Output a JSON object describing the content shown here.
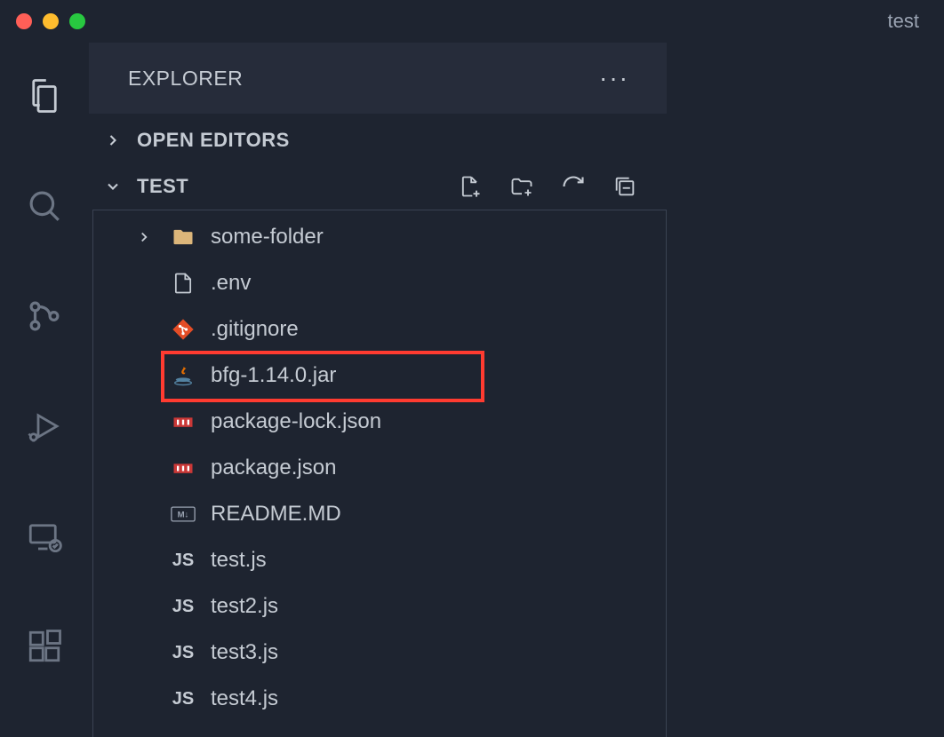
{
  "window": {
    "title": "test"
  },
  "sidebar": {
    "header": "EXPLORER",
    "sections": {
      "open_editors": "OPEN EDITORS",
      "folder": "TEST"
    }
  },
  "tree": {
    "items": [
      {
        "name": "some-folder",
        "type": "folder"
      },
      {
        "name": ".env",
        "type": "file-generic"
      },
      {
        "name": ".gitignore",
        "type": "git"
      },
      {
        "name": "bfg-1.14.0.jar",
        "type": "java",
        "highlighted": true
      },
      {
        "name": "package-lock.json",
        "type": "npm"
      },
      {
        "name": "package.json",
        "type": "npm"
      },
      {
        "name": "README.MD",
        "type": "md"
      },
      {
        "name": "test.js",
        "type": "js"
      },
      {
        "name": "test2.js",
        "type": "js"
      },
      {
        "name": "test3.js",
        "type": "js"
      },
      {
        "name": "test4.js",
        "type": "js"
      }
    ]
  },
  "icons": {
    "js_label": "JS",
    "md_label": "M↓"
  }
}
